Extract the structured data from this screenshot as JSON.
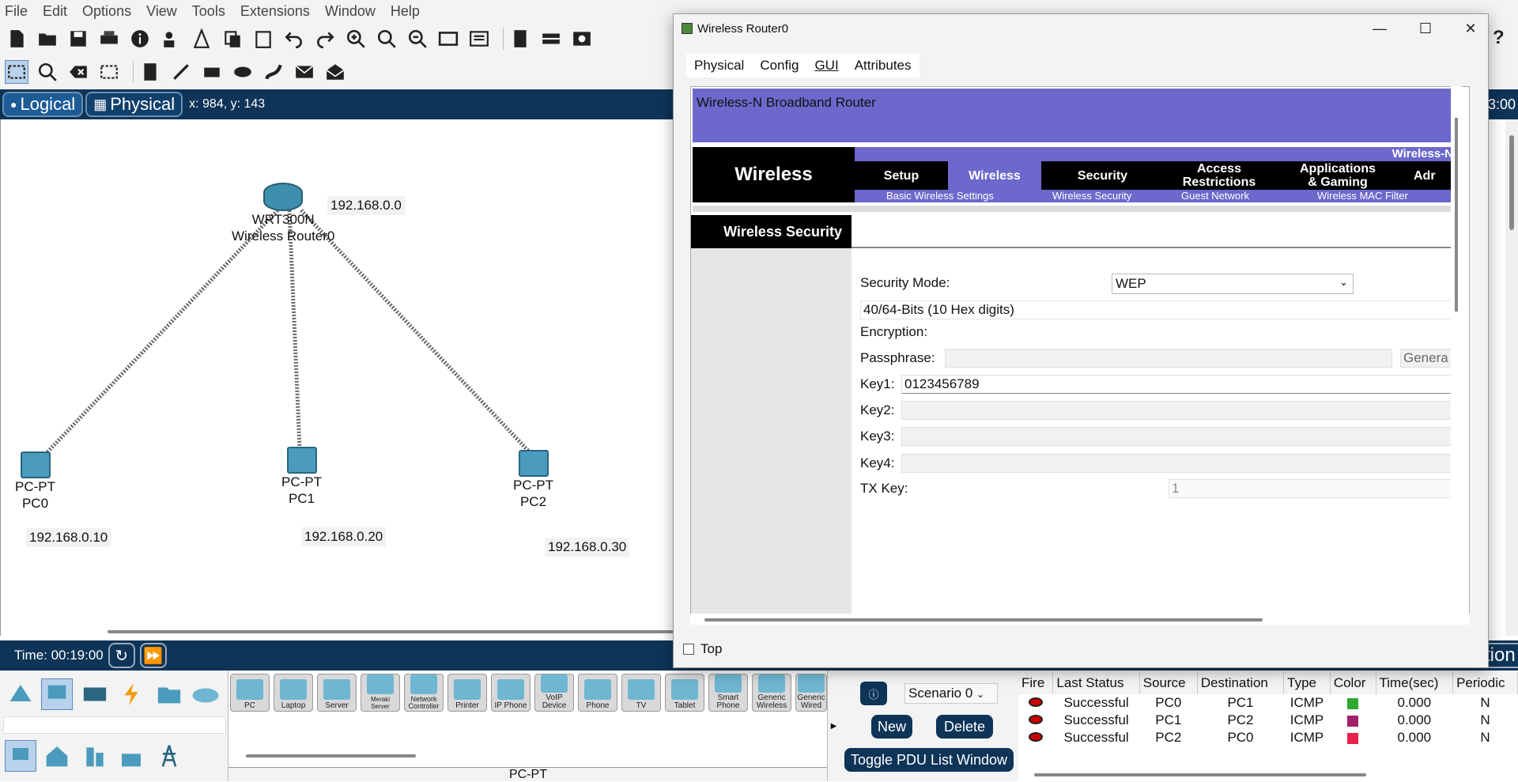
{
  "menu": [
    "File",
    "Edit",
    "Options",
    "View",
    "Tools",
    "Extensions",
    "Window",
    "Help"
  ],
  "mode": {
    "logical": "Logical",
    "physical": "Physical",
    "coords": "x: 984, y: 143",
    "clock_fragment": "3:00"
  },
  "network": {
    "router": {
      "model": "WRT300N",
      "name": "Wireless Router0",
      "ip": "192.168.0.0"
    },
    "pcs": [
      {
        "model": "PC-PT",
        "name": "PC0",
        "ip": "192.168.0.10"
      },
      {
        "model": "PC-PT",
        "name": "PC1",
        "ip": "192.168.0.20"
      },
      {
        "model": "PC-PT",
        "name": "PC2",
        "ip": "192.168.0.30"
      }
    ]
  },
  "time": {
    "label": "Time: 00:19:00"
  },
  "right_fragment": "tion",
  "devices": [
    "PC",
    "Laptop",
    "Server",
    "Meraki Server",
    "Network Controller",
    "Printer",
    "IP Phone",
    "VoIP Device",
    "Phone",
    "TV",
    "Tablet",
    "Smart Phone",
    "Generic Wireless",
    "Generic Wired"
  ],
  "device_caption": "PC-PT",
  "pdu": {
    "scenario": "Scenario 0",
    "new_label": "New",
    "delete_label": "Delete",
    "toggle_label": "Toggle PDU List Window",
    "headers": [
      "Fire",
      "Last Status",
      "Source",
      "Destination",
      "Type",
      "Color",
      "Time(sec)",
      "Periodic"
    ],
    "rows": [
      {
        "status": "Successful",
        "source": "PC0",
        "dest": "PC1",
        "type": "ICMP",
        "color": "#2fa82f",
        "time": "0.000",
        "periodic": "N"
      },
      {
        "status": "Successful",
        "source": "PC1",
        "dest": "PC2",
        "type": "ICMP",
        "color": "#a0206a",
        "time": "0.000",
        "periodic": "N"
      },
      {
        "status": "Successful",
        "source": "PC2",
        "dest": "PC0",
        "type": "ICMP",
        "color": "#e8224a",
        "time": "0.000",
        "periodic": "N"
      }
    ]
  },
  "dialog": {
    "title": "Wireless Router0",
    "tabs": [
      "Physical",
      "Config",
      "GUI",
      "Attributes"
    ],
    "active_tab": "GUI",
    "banner": "Wireless-N Broadband Router",
    "strip_right": "Wireless-N",
    "logo": "Wireless",
    "nav": {
      "setup": "Setup",
      "wireless": "Wireless",
      "security": "Security",
      "access1": "Access",
      "access2": "Restrictions",
      "apps1": "Applications",
      "apps2": "& Gaming",
      "admin": "Adr"
    },
    "sub": {
      "basic": "Basic Wireless Settings",
      "security": "Wireless Security",
      "guest": "Guest Network",
      "mac": "Wireless MAC Filter"
    },
    "section": "Wireless Security",
    "security_mode_label": "Security Mode:",
    "security_mode": "WEP",
    "bits": "40/64-Bits (10 Hex digits)",
    "encryption_label": "Encryption:",
    "passphrase_label": "Passphrase:",
    "generate": "Genera",
    "key1_label": "Key1:",
    "key1": "0123456789",
    "key2_label": "Key2:",
    "key3_label": "Key3:",
    "key4_label": "Key4:",
    "txkey_label": "TX Key:",
    "txkey": "1",
    "top_label": "Top"
  }
}
